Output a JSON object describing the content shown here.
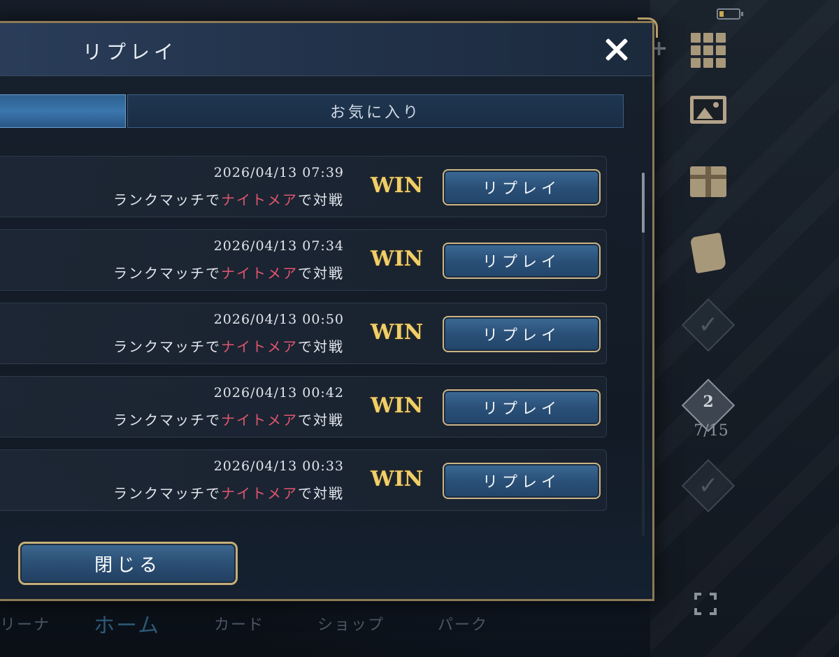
{
  "dialog": {
    "title": "リプレイ",
    "tabs": {
      "favorites": "お気に入り"
    },
    "close_button_label": "閉じる"
  },
  "replays": [
    {
      "date": "2026/04/13 07:39",
      "desc_prefix": "ランクマッチで",
      "mode": "ナイトメア",
      "desc_suffix": "で対戦",
      "result": "WIN",
      "button": "リプレイ"
    },
    {
      "date": "2026/04/13 07:34",
      "desc_prefix": "ランクマッチで",
      "mode": "ナイトメア",
      "desc_suffix": "で対戦",
      "result": "WIN",
      "button": "リプレイ"
    },
    {
      "date": "2026/04/13 00:50",
      "desc_prefix": "ランクマッチで",
      "mode": "ナイトメア",
      "desc_suffix": "で対戦",
      "result": "WIN",
      "button": "リプレイ"
    },
    {
      "date": "2026/04/13 00:42",
      "desc_prefix": "ランクマッチで",
      "mode": "ナイトメア",
      "desc_suffix": "で対戦",
      "result": "WIN",
      "button": "リプレイ"
    },
    {
      "date": "2026/04/13 00:33",
      "desc_prefix": "ランクマッチで",
      "mode": "ナイトメア",
      "desc_suffix": "で対戦",
      "result": "WIN",
      "button": "リプレイ"
    }
  ],
  "side_panel": {
    "mission_level": "2",
    "mission_progress": "7/15",
    "icons": [
      "battery-icon",
      "grid-menu-icon",
      "photo-edit-icon",
      "gift-icon",
      "scroll-icon",
      "check-icon",
      "fullscreen-icon"
    ]
  },
  "bottom_nav": {
    "items": [
      "リーナ",
      "ホーム",
      "カード",
      "ショップ",
      "パーク"
    ],
    "active": "ホーム"
  },
  "colors": {
    "accent_gold": "#f0cf6a",
    "highlight_red": "#e0566f",
    "button_blue": "#2a5078",
    "frame_gold": "#8c7a55"
  }
}
